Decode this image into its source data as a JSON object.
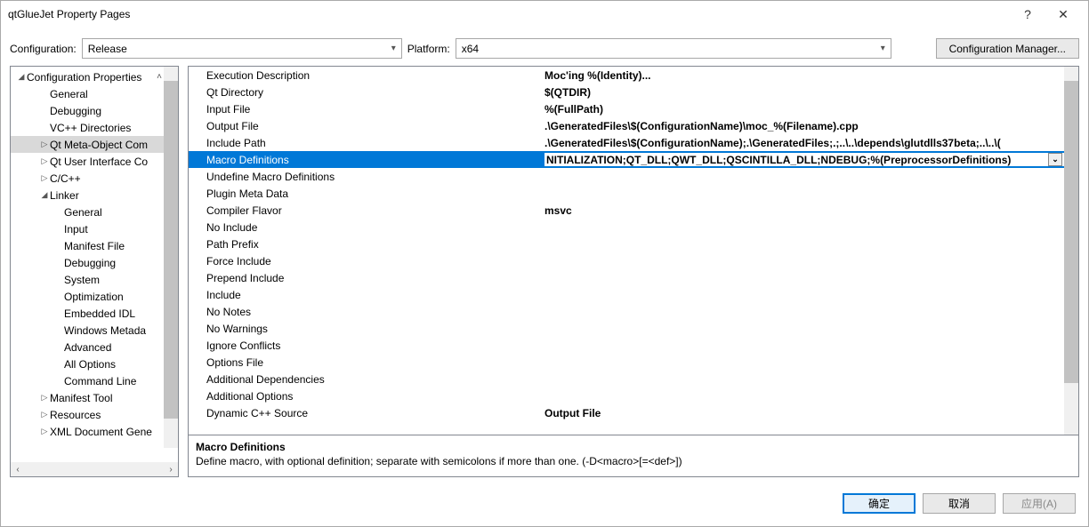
{
  "window": {
    "title": "qtGlueJet Property Pages"
  },
  "toolbar": {
    "config_label": "Configuration:",
    "config_value": "Release",
    "platform_label": "Platform:",
    "platform_value": "x64",
    "config_mgr": "Configuration Manager..."
  },
  "tree": {
    "root": "Configuration Properties",
    "items": [
      {
        "label": "General",
        "indent": 2
      },
      {
        "label": "Debugging",
        "indent": 2
      },
      {
        "label": "VC++ Directories",
        "indent": 2
      },
      {
        "label": "Qt Meta-Object Com",
        "indent": 2,
        "tw": "▷",
        "sel": true
      },
      {
        "label": "Qt User Interface Co",
        "indent": 2,
        "tw": "▷"
      },
      {
        "label": "C/C++",
        "indent": 2,
        "tw": "▷"
      },
      {
        "label": "Linker",
        "indent": 2,
        "tw": "◢"
      },
      {
        "label": "General",
        "indent": 3
      },
      {
        "label": "Input",
        "indent": 3
      },
      {
        "label": "Manifest File",
        "indent": 3
      },
      {
        "label": "Debugging",
        "indent": 3
      },
      {
        "label": "System",
        "indent": 3
      },
      {
        "label": "Optimization",
        "indent": 3
      },
      {
        "label": "Embedded IDL",
        "indent": 3
      },
      {
        "label": "Windows Metada",
        "indent": 3
      },
      {
        "label": "Advanced",
        "indent": 3
      },
      {
        "label": "All Options",
        "indent": 3
      },
      {
        "label": "Command Line",
        "indent": 3
      },
      {
        "label": "Manifest Tool",
        "indent": 2,
        "tw": "▷"
      },
      {
        "label": "Resources",
        "indent": 2,
        "tw": "▷"
      },
      {
        "label": "XML Document Gene",
        "indent": 2,
        "tw": "▷"
      }
    ]
  },
  "grid": {
    "rows": [
      {
        "name": "Execution Description",
        "val": "Moc'ing %(Identity)...",
        "bold": true
      },
      {
        "name": "Qt Directory",
        "val": "$(QTDIR)",
        "bold": true
      },
      {
        "name": "Input File",
        "val": "%(FullPath)",
        "bold": true
      },
      {
        "name": "Output File",
        "val": ".\\GeneratedFiles\\$(ConfigurationName)\\moc_%(Filename).cpp",
        "bold": true
      },
      {
        "name": "Include Path",
        "val": ".\\GeneratedFiles\\$(ConfigurationName);.\\GeneratedFiles;.;..\\..\\depends\\glutdlls37beta;..\\..\\(",
        "bold": true
      },
      {
        "name": "Macro Definitions",
        "val": "NITIALIZATION;QT_DLL;QWT_DLL;QSCINTILLA_DLL;NDEBUG;%(PreprocessorDefinitions)",
        "sel": true
      },
      {
        "name": "Undefine Macro Definitions",
        "val": ""
      },
      {
        "name": "Plugin Meta Data",
        "val": ""
      },
      {
        "name": "Compiler Flavor",
        "val": "msvc",
        "bold": true
      },
      {
        "name": "No Include",
        "val": ""
      },
      {
        "name": "Path Prefix",
        "val": ""
      },
      {
        "name": "Force Include",
        "val": ""
      },
      {
        "name": "Prepend Include",
        "val": ""
      },
      {
        "name": "Include",
        "val": ""
      },
      {
        "name": "No Notes",
        "val": ""
      },
      {
        "name": "No Warnings",
        "val": ""
      },
      {
        "name": "Ignore Conflicts",
        "val": ""
      },
      {
        "name": "Options File",
        "val": ""
      },
      {
        "name": "Additional Dependencies",
        "val": ""
      },
      {
        "name": "Additional Options",
        "val": ""
      },
      {
        "name": "Dynamic C++ Source",
        "val": "Output File",
        "bold": true
      }
    ]
  },
  "desc": {
    "title": "Macro Definitions",
    "text": "Define macro, with optional definition; separate with semicolons if more than one. (-D<macro>[=<def>])"
  },
  "footer": {
    "ok": "确定",
    "cancel": "取消",
    "apply": "应用(A)"
  },
  "help": "?"
}
